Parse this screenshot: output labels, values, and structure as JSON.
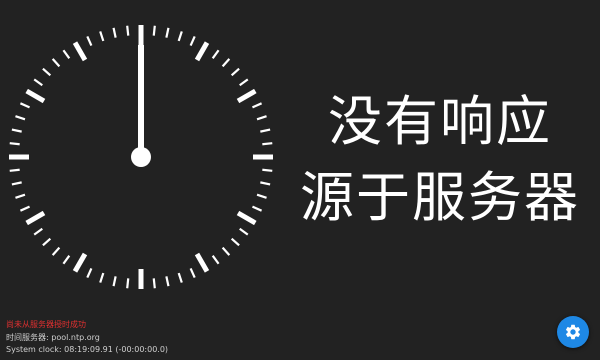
{
  "headline": {
    "line1": "没有响应",
    "line2": "源于服务器"
  },
  "clock": {
    "hour_hand_position_hours": 12,
    "minute_hand_position_minutes": 0,
    "face_color": "#ffffff",
    "background_color": "#222222"
  },
  "status": {
    "error_text": "尚未从服务器授时成功",
    "error_color": "#e03030",
    "server_text": "时间服务器: pool.ntp.org",
    "system_clock_text": "System clock: 08:19:09.91 (-00:00:00.0)",
    "text_color": "#cfcfcf"
  },
  "settings_button": {
    "icon": "gear-icon",
    "color": "#1e88e5"
  }
}
